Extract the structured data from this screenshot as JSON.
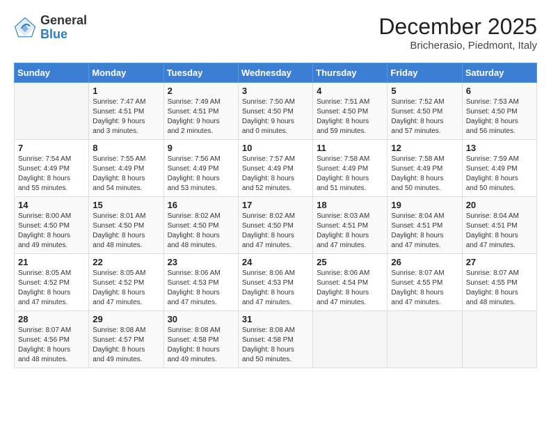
{
  "header": {
    "logo_general": "General",
    "logo_blue": "Blue",
    "month_title": "December 2025",
    "location": "Bricherasio, Piedmont, Italy"
  },
  "calendar": {
    "weekdays": [
      "Sunday",
      "Monday",
      "Tuesday",
      "Wednesday",
      "Thursday",
      "Friday",
      "Saturday"
    ],
    "weeks": [
      [
        {
          "day": "",
          "info": ""
        },
        {
          "day": "1",
          "info": "Sunrise: 7:47 AM\nSunset: 4:51 PM\nDaylight: 9 hours\nand 3 minutes."
        },
        {
          "day": "2",
          "info": "Sunrise: 7:49 AM\nSunset: 4:51 PM\nDaylight: 9 hours\nand 2 minutes."
        },
        {
          "day": "3",
          "info": "Sunrise: 7:50 AM\nSunset: 4:50 PM\nDaylight: 9 hours\nand 0 minutes."
        },
        {
          "day": "4",
          "info": "Sunrise: 7:51 AM\nSunset: 4:50 PM\nDaylight: 8 hours\nand 59 minutes."
        },
        {
          "day": "5",
          "info": "Sunrise: 7:52 AM\nSunset: 4:50 PM\nDaylight: 8 hours\nand 57 minutes."
        },
        {
          "day": "6",
          "info": "Sunrise: 7:53 AM\nSunset: 4:50 PM\nDaylight: 8 hours\nand 56 minutes."
        }
      ],
      [
        {
          "day": "7",
          "info": "Sunrise: 7:54 AM\nSunset: 4:49 PM\nDaylight: 8 hours\nand 55 minutes."
        },
        {
          "day": "8",
          "info": "Sunrise: 7:55 AM\nSunset: 4:49 PM\nDaylight: 8 hours\nand 54 minutes."
        },
        {
          "day": "9",
          "info": "Sunrise: 7:56 AM\nSunset: 4:49 PM\nDaylight: 8 hours\nand 53 minutes."
        },
        {
          "day": "10",
          "info": "Sunrise: 7:57 AM\nSunset: 4:49 PM\nDaylight: 8 hours\nand 52 minutes."
        },
        {
          "day": "11",
          "info": "Sunrise: 7:58 AM\nSunset: 4:49 PM\nDaylight: 8 hours\nand 51 minutes."
        },
        {
          "day": "12",
          "info": "Sunrise: 7:58 AM\nSunset: 4:49 PM\nDaylight: 8 hours\nand 50 minutes."
        },
        {
          "day": "13",
          "info": "Sunrise: 7:59 AM\nSunset: 4:49 PM\nDaylight: 8 hours\nand 50 minutes."
        }
      ],
      [
        {
          "day": "14",
          "info": "Sunrise: 8:00 AM\nSunset: 4:50 PM\nDaylight: 8 hours\nand 49 minutes."
        },
        {
          "day": "15",
          "info": "Sunrise: 8:01 AM\nSunset: 4:50 PM\nDaylight: 8 hours\nand 48 minutes."
        },
        {
          "day": "16",
          "info": "Sunrise: 8:02 AM\nSunset: 4:50 PM\nDaylight: 8 hours\nand 48 minutes."
        },
        {
          "day": "17",
          "info": "Sunrise: 8:02 AM\nSunset: 4:50 PM\nDaylight: 8 hours\nand 47 minutes."
        },
        {
          "day": "18",
          "info": "Sunrise: 8:03 AM\nSunset: 4:51 PM\nDaylight: 8 hours\nand 47 minutes."
        },
        {
          "day": "19",
          "info": "Sunrise: 8:04 AM\nSunset: 4:51 PM\nDaylight: 8 hours\nand 47 minutes."
        },
        {
          "day": "20",
          "info": "Sunrise: 8:04 AM\nSunset: 4:51 PM\nDaylight: 8 hours\nand 47 minutes."
        }
      ],
      [
        {
          "day": "21",
          "info": "Sunrise: 8:05 AM\nSunset: 4:52 PM\nDaylight: 8 hours\nand 47 minutes."
        },
        {
          "day": "22",
          "info": "Sunrise: 8:05 AM\nSunset: 4:52 PM\nDaylight: 8 hours\nand 47 minutes."
        },
        {
          "day": "23",
          "info": "Sunrise: 8:06 AM\nSunset: 4:53 PM\nDaylight: 8 hours\nand 47 minutes."
        },
        {
          "day": "24",
          "info": "Sunrise: 8:06 AM\nSunset: 4:53 PM\nDaylight: 8 hours\nand 47 minutes."
        },
        {
          "day": "25",
          "info": "Sunrise: 8:06 AM\nSunset: 4:54 PM\nDaylight: 8 hours\nand 47 minutes."
        },
        {
          "day": "26",
          "info": "Sunrise: 8:07 AM\nSunset: 4:55 PM\nDaylight: 8 hours\nand 47 minutes."
        },
        {
          "day": "27",
          "info": "Sunrise: 8:07 AM\nSunset: 4:55 PM\nDaylight: 8 hours\nand 48 minutes."
        }
      ],
      [
        {
          "day": "28",
          "info": "Sunrise: 8:07 AM\nSunset: 4:56 PM\nDaylight: 8 hours\nand 48 minutes."
        },
        {
          "day": "29",
          "info": "Sunrise: 8:08 AM\nSunset: 4:57 PM\nDaylight: 8 hours\nand 49 minutes."
        },
        {
          "day": "30",
          "info": "Sunrise: 8:08 AM\nSunset: 4:58 PM\nDaylight: 8 hours\nand 49 minutes."
        },
        {
          "day": "31",
          "info": "Sunrise: 8:08 AM\nSunset: 4:58 PM\nDaylight: 8 hours\nand 50 minutes."
        },
        {
          "day": "",
          "info": ""
        },
        {
          "day": "",
          "info": ""
        },
        {
          "day": "",
          "info": ""
        }
      ]
    ]
  }
}
